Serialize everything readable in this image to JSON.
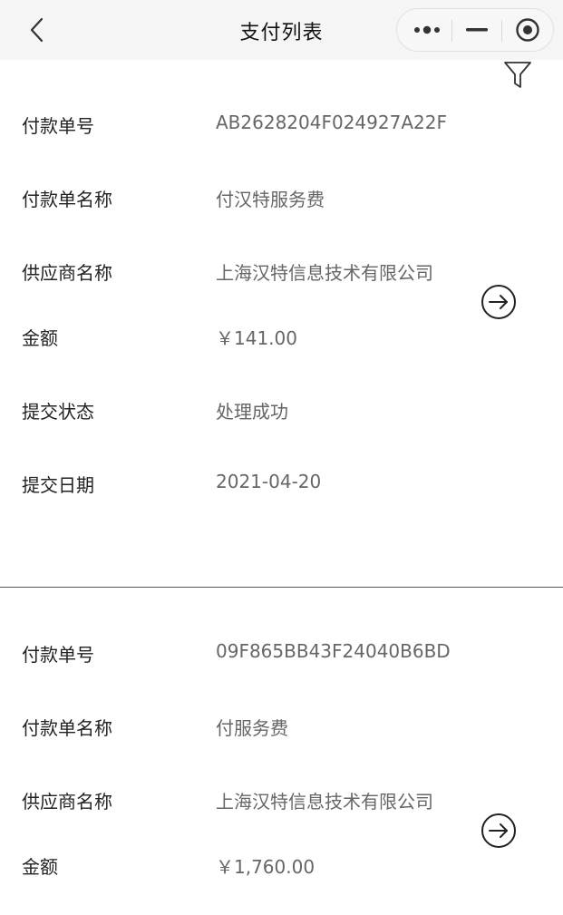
{
  "nav": {
    "title": "支付列表",
    "back_icon": "chevron-left-icon",
    "more_icon": "more-dots-icon",
    "minimize_icon": "minus-icon",
    "close_icon": "target-circle-icon"
  },
  "filter_icon": "filter-funnel-icon",
  "labels": {
    "order_no": "付款单号",
    "order_name": "付款单名称",
    "supplier": "供应商名称",
    "amount": "金额",
    "status": "提交状态",
    "date": "提交日期"
  },
  "records": [
    {
      "order_no": "AB2628204F024927A22F",
      "order_name": "付汉特服务费",
      "supplier": "上海汉特信息技术有限公司",
      "amount": "￥141.00",
      "status": "处理成功",
      "date": "2021-04-20"
    },
    {
      "order_no": "09F865BB43F24040B6BD",
      "order_name": "付服务费",
      "supplier": "上海汉特信息技术有限公司",
      "amount": "￥1,760.00"
    }
  ],
  "colors": {
    "nav_bg": "#f5f5f5",
    "label": "#222222",
    "value": "#666666",
    "divider": "#555555"
  }
}
